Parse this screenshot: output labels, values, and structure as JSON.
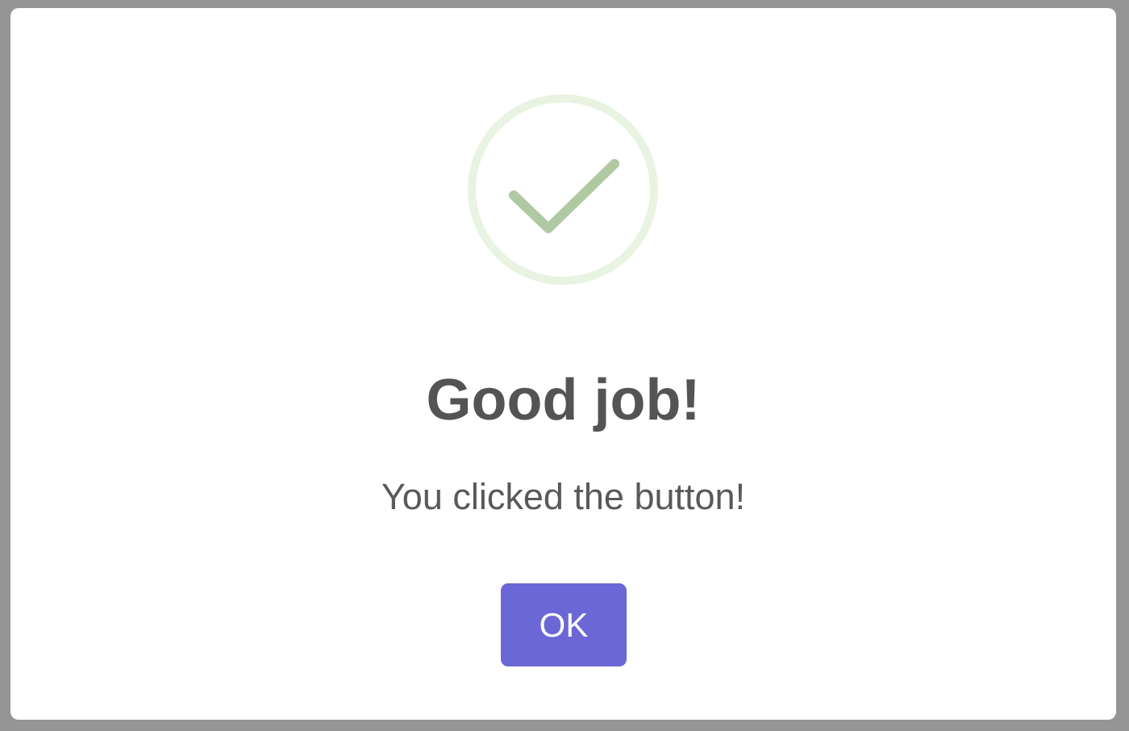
{
  "dialog": {
    "icon": "success-check-icon",
    "title": "Good job!",
    "text": "You clicked the button!",
    "confirm_label": "OK"
  },
  "colors": {
    "backdrop": "#959595",
    "dialog_background": "#ffffff",
    "icon_ring": "#e8f3e1",
    "icon_check": "#b0c9a3",
    "title_text": "#545454",
    "body_text": "#595959",
    "confirm_button": "#6b67d6",
    "confirm_button_text": "#ffffff"
  }
}
